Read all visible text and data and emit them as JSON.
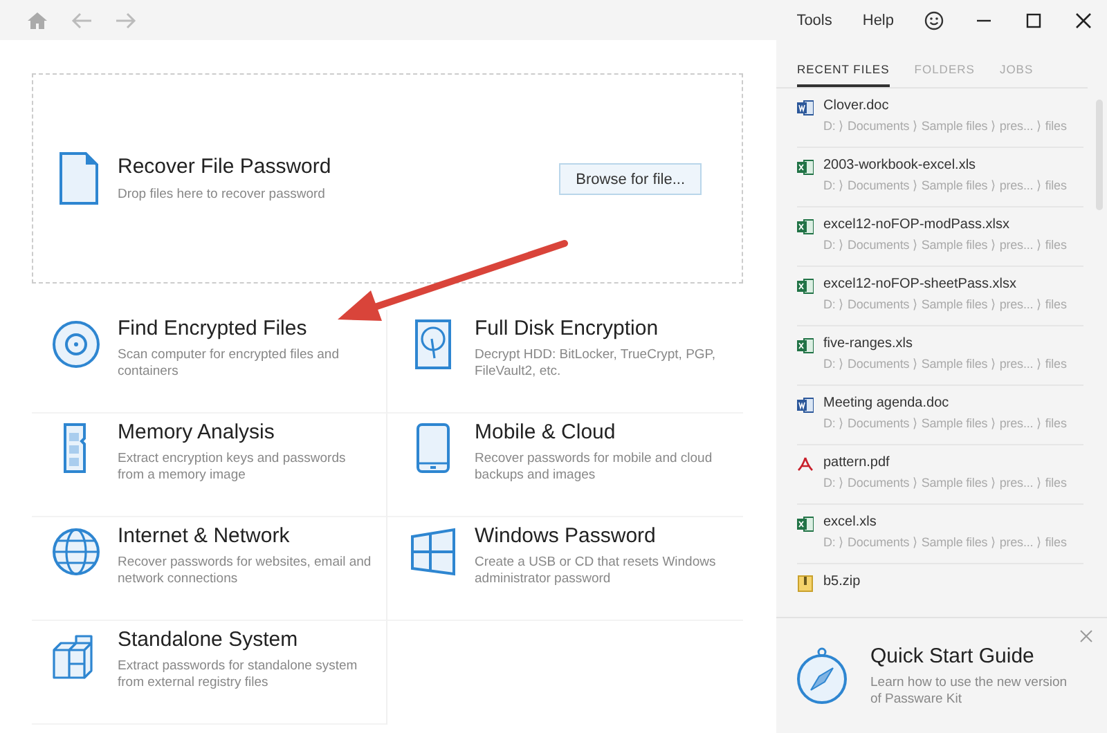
{
  "menu": [
    "Tools",
    "Help"
  ],
  "drop_zone": {
    "title": "Recover File Password",
    "subtitle": "Drop files here to recover password",
    "button": "Browse for file..."
  },
  "features": [
    {
      "kind": "disc",
      "title": "Find Encrypted Files",
      "description": "Scan computer for encrypted files and containers"
    },
    {
      "kind": "disk",
      "title": "Full Disk Encryption",
      "description": "Decrypt HDD: BitLocker, TrueCrypt, PGP, FileVault2, etc."
    },
    {
      "kind": "memory",
      "title": "Memory Analysis",
      "description": "Extract encryption keys and passwords from a memory image"
    },
    {
      "kind": "mobile",
      "title": "Mobile & Cloud",
      "description": "Recover passwords for mobile and cloud backups and images"
    },
    {
      "kind": "globe",
      "title": "Internet & Network",
      "description": "Recover passwords for websites, email and network connections"
    },
    {
      "kind": "windows",
      "title": "Windows Password",
      "description": "Create a USB or CD that resets Windows administrator password"
    },
    {
      "kind": "cubes",
      "title": "Standalone System",
      "description": "Extract passwords for standalone system from external registry files"
    }
  ],
  "tabs": [
    {
      "label": "RECENT FILES",
      "selected": true
    },
    {
      "label": "FOLDERS",
      "selected": false
    },
    {
      "label": "JOBS",
      "selected": false
    }
  ],
  "recent_files": [
    {
      "kind": "word",
      "name": "Clover.doc",
      "path": "D: ⟩ Documents ⟩ Sample files ⟩ pres... ⟩ files"
    },
    {
      "kind": "excel",
      "name": "2003-workbook-excel.xls",
      "path": "D: ⟩ Documents ⟩ Sample files ⟩ pres... ⟩ files"
    },
    {
      "kind": "excel",
      "name": "excel12-noFOP-modPass.xlsx",
      "path": "D: ⟩ Documents ⟩ Sample files ⟩ pres... ⟩ files"
    },
    {
      "kind": "excel",
      "name": "excel12-noFOP-sheetPass.xlsx",
      "path": "D: ⟩ Documents ⟩ Sample files ⟩ pres... ⟩ files"
    },
    {
      "kind": "excel",
      "name": "five-ranges.xls",
      "path": "D: ⟩ Documents ⟩ Sample files ⟩ pres... ⟩ files"
    },
    {
      "kind": "word",
      "name": "Meeting agenda.doc",
      "path": "D: ⟩ Documents ⟩ Sample files ⟩ pres... ⟩ files"
    },
    {
      "kind": "pdf",
      "name": "pattern.pdf",
      "path": "D: ⟩ Documents ⟩ Sample files ⟩ pres... ⟩ files"
    },
    {
      "kind": "excel",
      "name": "excel.xls",
      "path": "D: ⟩ Documents ⟩ Sample files ⟩ pres... ⟩ files"
    },
    {
      "kind": "zip",
      "name": "b5.zip"
    }
  ],
  "quick_start": {
    "title": "Quick Start Guide",
    "description": "Learn how to use the new version of Passware Kit"
  }
}
